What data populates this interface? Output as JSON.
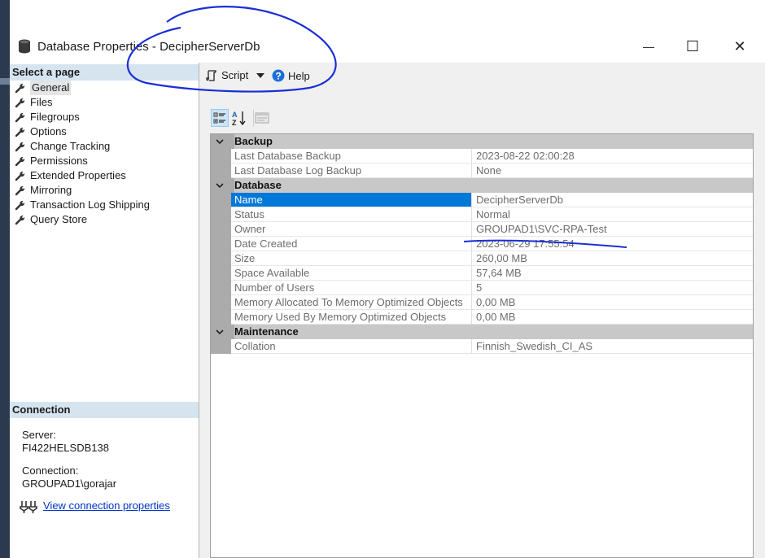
{
  "window": {
    "title": "Database Properties - DecipherServerDb",
    "minimize": "—",
    "maximize": "☐",
    "close": "✕"
  },
  "left": {
    "select_page_header": "Select a page",
    "pages": [
      {
        "label": "General",
        "selected": true
      },
      {
        "label": "Files"
      },
      {
        "label": "Filegroups"
      },
      {
        "label": "Options"
      },
      {
        "label": "Change Tracking"
      },
      {
        "label": "Permissions"
      },
      {
        "label": "Extended Properties"
      },
      {
        "label": "Mirroring"
      },
      {
        "label": "Transaction Log Shipping"
      },
      {
        "label": "Query Store"
      }
    ],
    "connection_header": "Connection",
    "server_label": "Server:",
    "server_value": "FI422HELSDB138",
    "connection_label": "Connection:",
    "connection_value": "GROUPAD1\\gorajar",
    "view_connection_link": "View connection properties"
  },
  "toolbar": {
    "script_label": "Script",
    "help_label": "Help"
  },
  "grid": {
    "categories": [
      {
        "name": "Backup",
        "rows": [
          {
            "name": "Last Database Backup",
            "value": "2023-08-22 02:00:28"
          },
          {
            "name": "Last Database Log Backup",
            "value": "None"
          }
        ]
      },
      {
        "name": "Database",
        "rows": [
          {
            "name": "Name",
            "value": "DecipherServerDb",
            "selected": true
          },
          {
            "name": "Status",
            "value": "Normal"
          },
          {
            "name": "Owner",
            "value": "GROUPAD1\\SVC-RPA-Test"
          },
          {
            "name": "Date Created",
            "value": "2023-06-29 17:55:54"
          },
          {
            "name": "Size",
            "value": "260,00 MB"
          },
          {
            "name": "Space Available",
            "value": "57,64 MB"
          },
          {
            "name": "Number of Users",
            "value": "5"
          },
          {
            "name": "Memory Allocated To Memory Optimized Objects",
            "value": "0,00 MB"
          },
          {
            "name": "Memory Used By Memory Optimized Objects",
            "value": "0,00 MB"
          }
        ]
      },
      {
        "name": "Maintenance",
        "rows": [
          {
            "name": "Collation",
            "value": "Finnish_Swedish_CI_AS"
          }
        ]
      }
    ]
  },
  "colors": {
    "selection": "#0078d7",
    "annotation_ink": "#1a2fd6",
    "section_header": "#d6e4f0"
  }
}
